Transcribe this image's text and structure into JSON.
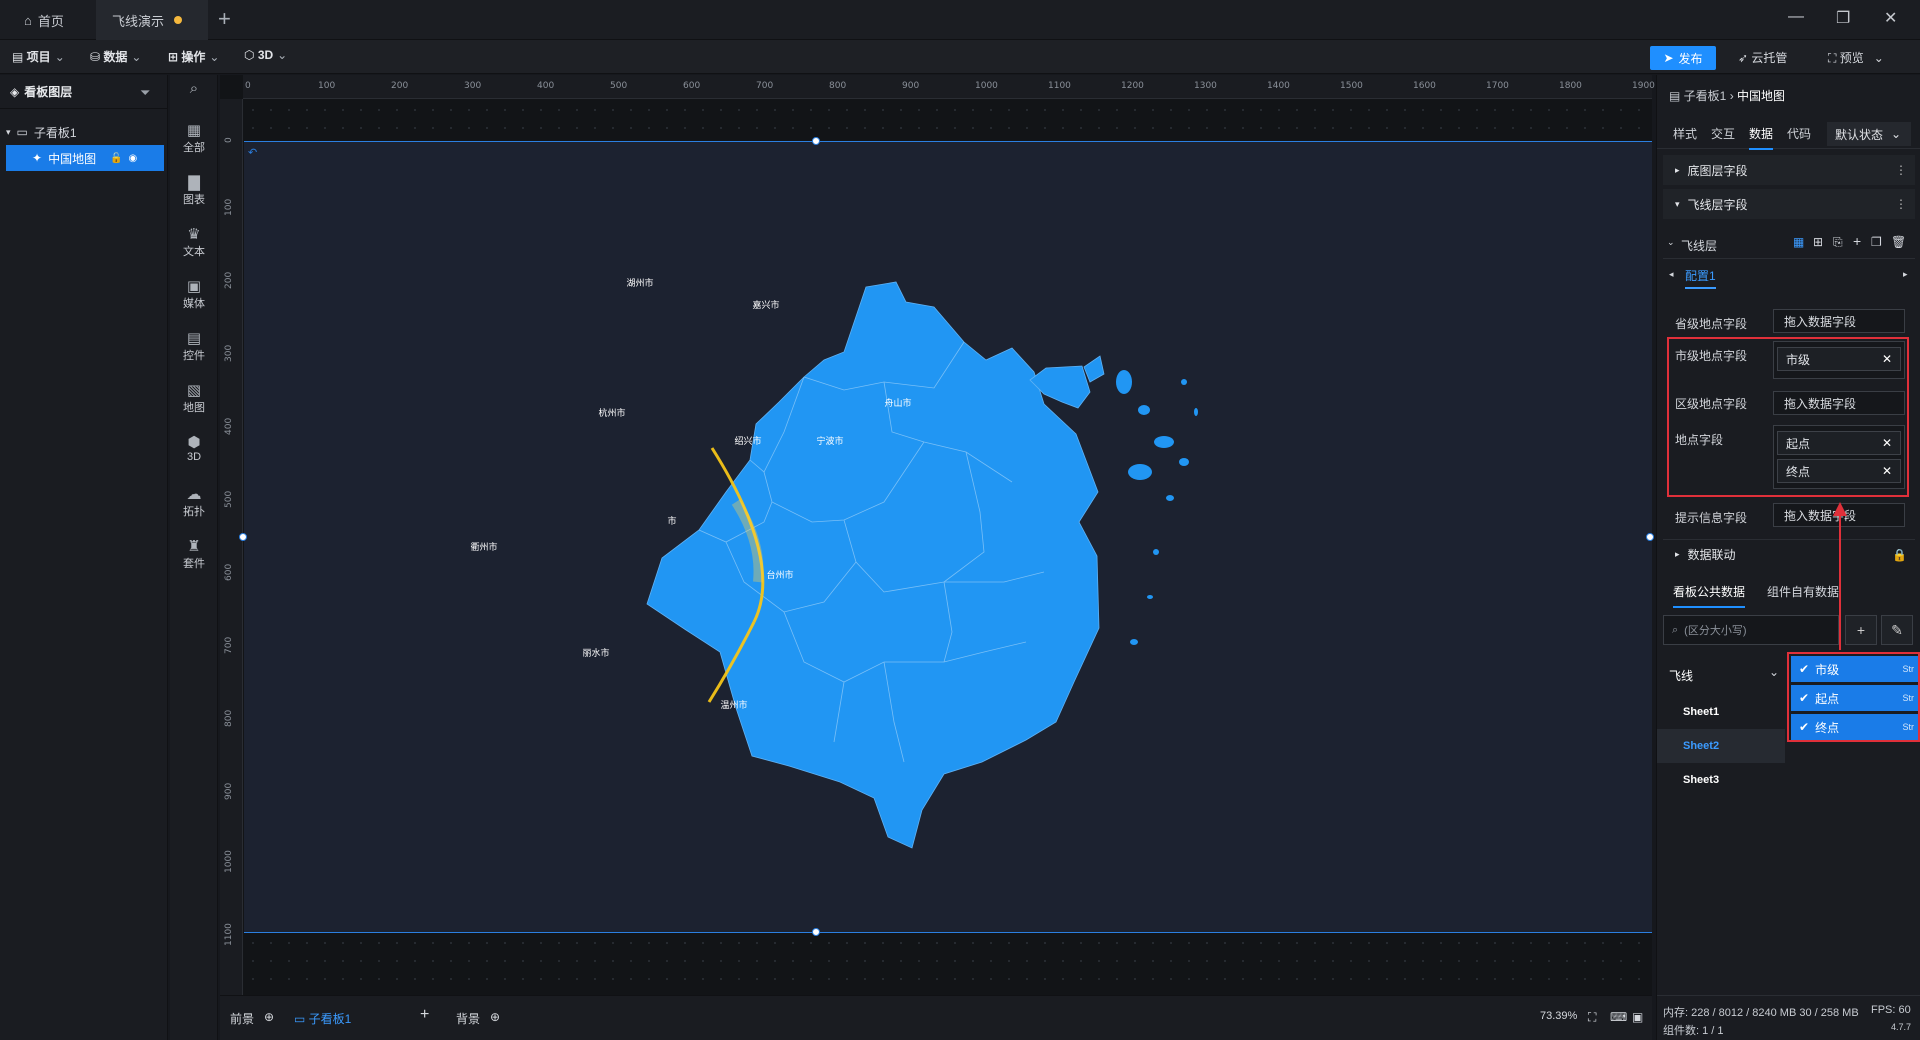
{
  "titlebar": {
    "tabs": [
      {
        "label": "首页"
      },
      {
        "label": "飞线演示"
      }
    ],
    "add": "+",
    "minimize": "—",
    "restore": "❐",
    "close": "✕"
  },
  "menubar": {
    "items": [
      {
        "label": "项目"
      },
      {
        "label": "数据"
      },
      {
        "label": "操作"
      },
      {
        "label": "3D"
      }
    ],
    "publish": "发布",
    "cloud": "云托管",
    "preview": "预览"
  },
  "layers": {
    "title": "看板图层",
    "board": "子看板1",
    "layer": "中国地图"
  },
  "categories": [
    {
      "label": "全部",
      "icon": "grid-icon"
    },
    {
      "label": "图表",
      "icon": "bar-chart-icon"
    },
    {
      "label": "文本",
      "icon": "text-icon"
    },
    {
      "label": "媒体",
      "icon": "media-icon"
    },
    {
      "label": "控件",
      "icon": "widget-icon"
    },
    {
      "label": "地图",
      "icon": "map-icon"
    },
    {
      "label": "3D",
      "icon": "cube-icon"
    },
    {
      "label": "拓扑",
      "icon": "topology-icon"
    },
    {
      "label": "套件",
      "icon": "kit-icon"
    }
  ],
  "ruler": {
    "top": [
      "0",
      "100",
      "200",
      "300",
      "400",
      "500",
      "600",
      "700",
      "800",
      "900",
      "1000",
      "1100",
      "1200",
      "1300",
      "1400",
      "1500",
      "1600",
      "1700",
      "1800",
      "1900"
    ],
    "left": [
      "0",
      "100",
      "200",
      "300",
      "400",
      "500",
      "600",
      "700",
      "800",
      "900",
      "1000",
      "1100"
    ]
  },
  "map": {
    "cities": [
      {
        "name": "湖州市"
      },
      {
        "name": "嘉兴市"
      },
      {
        "name": "杭州市"
      },
      {
        "name": "绍兴市"
      },
      {
        "name": "宁波市"
      },
      {
        "name": "舟山市"
      },
      {
        "name": "衢州市"
      },
      {
        "name": "市"
      },
      {
        "name": "台州市"
      },
      {
        "name": "丽水市"
      },
      {
        "name": "温州市"
      }
    ]
  },
  "scenes": {
    "front": "前景",
    "board": "子看板1",
    "add": "+",
    "back": "背景",
    "zoom": "73.39%"
  },
  "rpanel": {
    "crumb_parent": "子看板1",
    "crumb_current": "中国地图",
    "tabs": [
      "样式",
      "交互",
      "数据",
      "代码"
    ],
    "state": "默认状态",
    "sections": {
      "base": "底图层字段",
      "fly": "飞线层字段",
      "linkage": "数据联动"
    },
    "flylayer": {
      "title": "飞线层",
      "config": "配置1"
    },
    "fields": {
      "province": "省级地点字段",
      "city": "市级地点字段",
      "district": "区级地点字段",
      "location": "地点字段",
      "tooltip": "提示信息字段"
    },
    "placeholder": "拖入数据字段",
    "chips": {
      "city": "市级",
      "start": "起点",
      "end": "终点"
    },
    "data_tabs": {
      "public": "看板公共数据",
      "own": "组件自有数据"
    },
    "search_placeholder": "(区分大小写)",
    "datasource": "飞线",
    "sheets": [
      "Sheet1",
      "Sheet2",
      "Sheet3"
    ],
    "popup": [
      {
        "label": "市级",
        "type": "Str"
      },
      {
        "label": "起点",
        "type": "Str"
      },
      {
        "label": "终点",
        "type": "Str"
      }
    ],
    "status": {
      "memory": "内存: 228 / 8012 / 8240 MB  30 / 258 MB",
      "fps": "FPS: 60",
      "count": "组件数: 1 / 1",
      "version": "4.7.7"
    }
  },
  "colors": {
    "accent": "#1f8fff",
    "map_fill": "#2196f3",
    "flyline": "#f5c518",
    "highlight": "#e0303a"
  }
}
